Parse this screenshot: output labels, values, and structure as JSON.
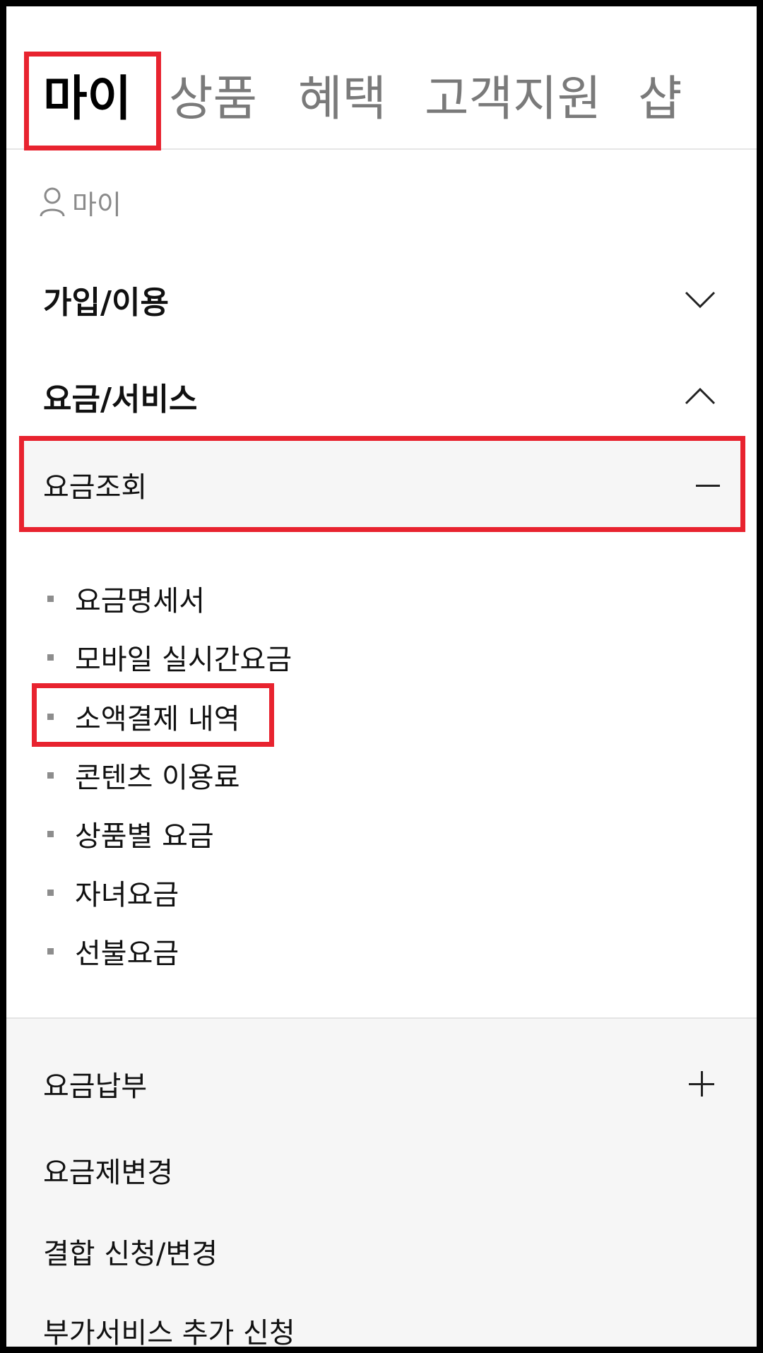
{
  "tabs": [
    {
      "label": "마이",
      "active": true
    },
    {
      "label": "상품",
      "active": false
    },
    {
      "label": "혜택",
      "active": false
    },
    {
      "label": "고객지원",
      "active": false
    },
    {
      "label": "샵",
      "active": false
    }
  ],
  "breadcrumb": {
    "icon": "user-icon",
    "label": "마이"
  },
  "sections": [
    {
      "label": "가입/이용",
      "state": "collapsed",
      "icon": "chevron-down-icon"
    },
    {
      "label": "요금/서비스",
      "state": "expanded",
      "icon": "chevron-up-icon"
    }
  ],
  "submenu": {
    "label": "요금조회",
    "icon": "minus-icon",
    "items": [
      "요금명세서",
      "모바일 실시간요금",
      "소액결제 내역",
      "콘텐츠 이용료",
      "상품별 요금",
      "자녀요금",
      "선불요금"
    ]
  },
  "more_menu": [
    {
      "label": "요금납부",
      "icon": "plus-icon"
    },
    {
      "label": "요금제변경"
    },
    {
      "label": "결합 신청/변경"
    },
    {
      "label": "부가서비스 추가 신청"
    }
  ],
  "colors": {
    "highlight": "#e8232f",
    "active_text": "#000000",
    "inactive_text": "#7a7a7a",
    "gray_bg": "#f6f6f6"
  }
}
